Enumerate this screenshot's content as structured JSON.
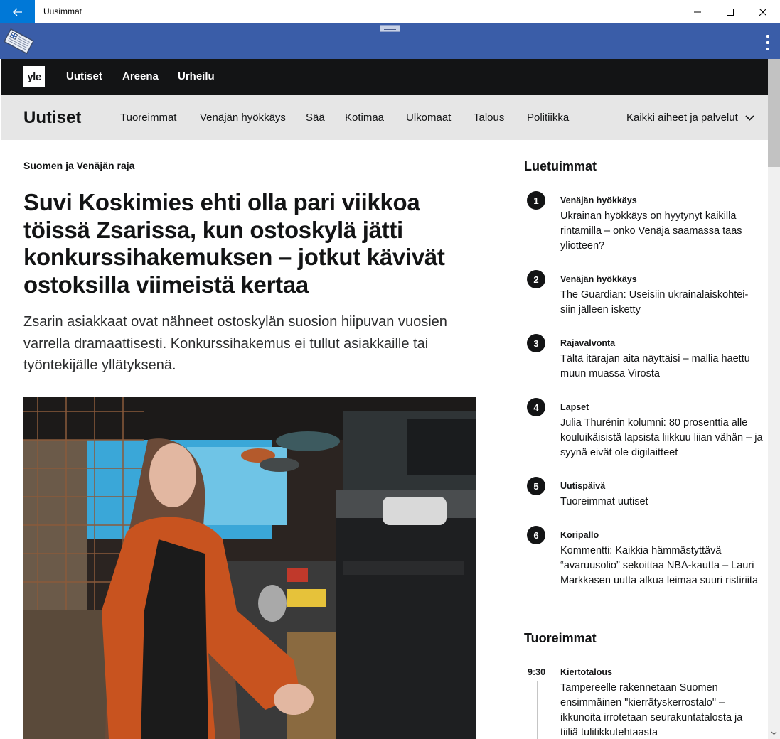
{
  "window": {
    "title": "Uusimmat"
  },
  "site": {
    "logo": "yle",
    "top_nav": [
      "Uutiset",
      "Areena",
      "Urheilu"
    ],
    "section_title": "Uutiset",
    "section_nav": [
      "Tuoreimmat",
      "Venäjän hyökkäys",
      "Sää",
      "Kotimaa",
      "Ulkomaat",
      "Talous",
      "Politiikka"
    ],
    "all_topics": "Kaikki aiheet ja palvelut"
  },
  "article": {
    "kicker": "Suomen ja Venäjän raja",
    "headline": "Suvi Koskimies ehti olla pari viikkoa töissä Zsarissa, kun ostoskylä jätti konkurssihakemuksen – jotkut kävivät ostoksilla viimeistä kertaa",
    "lead": "Zsarin asiakkaat ovat nähneet ostoskylän suosion hiipuvan vuosien varrella dramaattisesti. Konkurssihakemus ei tullut asiakkaille tai työntekijälle yllätyksenä."
  },
  "most_read": {
    "heading": "Luetuimmat",
    "items": [
      {
        "rank": "1",
        "category": "Venäjän hyökkäys",
        "title": "Ukrainan hyökkäys on hyytynyt kaikilla rintamilla – onko Venäjä saamassa taas yliotteen?"
      },
      {
        "rank": "2",
        "category": "Venäjän hyökkäys",
        "title": "The Guardian: Useisiin ukrainalaiskohtei-siin jälleen isketty"
      },
      {
        "rank": "3",
        "category": "Rajavalvonta",
        "title": "Tältä itärajan aita näyttäisi – mallia haettu muun muassa Virosta"
      },
      {
        "rank": "4",
        "category": "Lapset",
        "title": "Julia Thurénin kolumni: 80 prosenttia alle kouluikäisistä lapsista liikkuu liian vähän – ja syynä eivät ole digilaitteet"
      },
      {
        "rank": "5",
        "category": "Uutispäivä",
        "title": "Tuoreimmat uutiset"
      },
      {
        "rank": "6",
        "category": "Koripallo",
        "title": "Kommentti: Kaikkia hämmästyttävä “avaruusolio” sekoittaa NBA-kautta – Lauri Markkasen uutta alkua leimaa suuri ristiriita"
      }
    ]
  },
  "latest": {
    "heading": "Tuoreimmat",
    "items": [
      {
        "time": "9:30",
        "category": "Kiertotalous",
        "title": "Tampereelle rakennetaan Suomen ensimmäinen \"kierrätyskerrostalo\" – ikkunoita irrotetaan seurakuntatalosta ja tiiliä tulitikkutehtaasta"
      }
    ]
  },
  "colors": {
    "titlebar_back": "#0078d7",
    "appbar": "#3a5da8",
    "site_nav": "#131415",
    "section_nav": "#e6e6e6"
  }
}
